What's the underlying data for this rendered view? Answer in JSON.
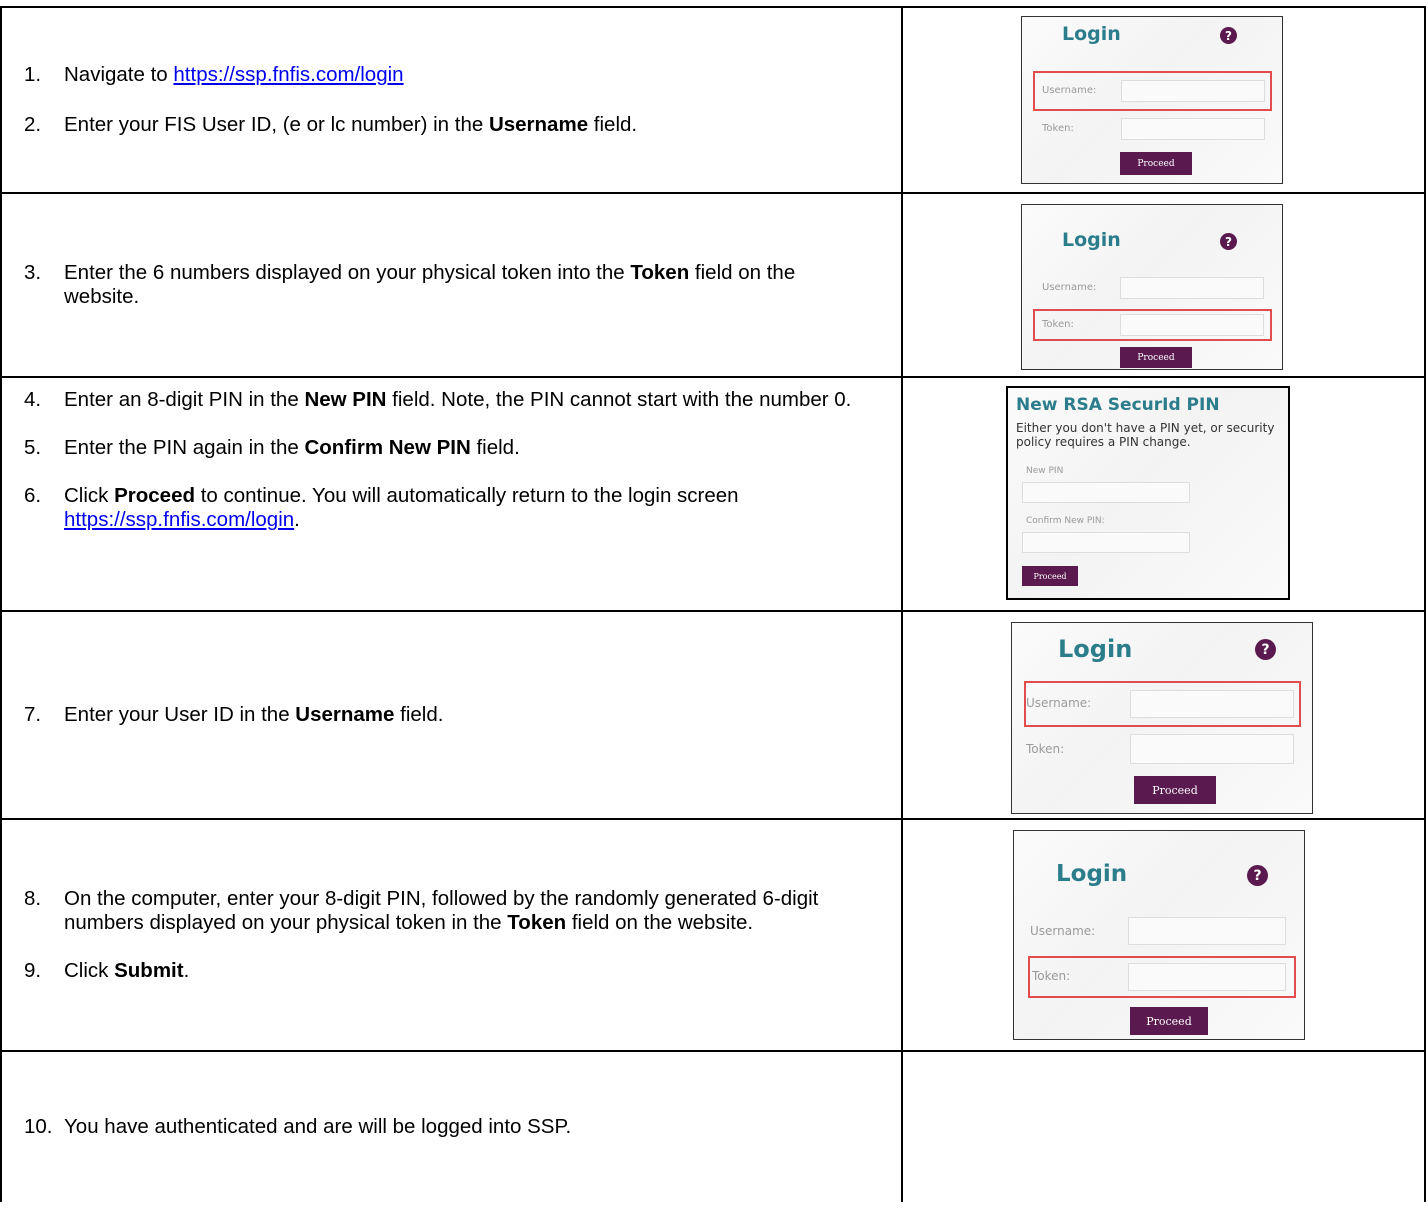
{
  "steps": {
    "s1": {
      "num": "1.",
      "prefix": "Navigate to ",
      "link": "https://ssp.fnfis.com/login"
    },
    "s2": {
      "num": "2.",
      "prefix": "Enter your FIS User ID, (e or lc number) in the ",
      "bold": "Username",
      "suffix": " field."
    },
    "s3": {
      "num": "3.",
      "prefix": "Enter the 6 numbers displayed on your physical token into the ",
      "bold": "Token",
      "suffix": " field on the website."
    },
    "s4": {
      "num": "4.",
      "prefix": "Enter an 8-digit PIN in the ",
      "bold": "New PIN",
      "suffix": " field. Note, the PIN cannot start with the number 0."
    },
    "s5": {
      "num": "5.",
      "prefix": "Enter the PIN again in the ",
      "bold": "Confirm New PIN",
      "suffix": " field."
    },
    "s6": {
      "num": "6.",
      "prefix": "Click ",
      "bold": "Proceed",
      "middle": " to continue. You will automatically return to the login screen ",
      "link": "https://ssp.fnfis.com/login",
      "suffix": "."
    },
    "s7": {
      "num": "7.",
      "prefix": "Enter your User ID in the ",
      "bold": "Username",
      "suffix": " field."
    },
    "s8": {
      "num": "8.",
      "prefix": "On the computer, enter your 8-digit PIN, followed by the randomly generated 6-digit numbers displayed on your physical token in the ",
      "bold": "Token",
      "suffix": " field on the website."
    },
    "s9": {
      "num": "9.",
      "prefix": "Click ",
      "bold": "Submit",
      "suffix": "."
    },
    "s10": {
      "num": "10.",
      "text": "You have authenticated and are will be logged into SSP."
    }
  },
  "login": {
    "title": "Login",
    "help_glyph": "?",
    "username_label": "Username:",
    "token_label": "Token:",
    "proceed_label": "Proceed"
  },
  "pin_screen": {
    "title": "New RSA SecurId PIN",
    "description": "Either you don't have a PIN yet, or security policy requires a PIN change.",
    "new_pin_label": "New PIN",
    "confirm_pin_label": "Confirm New PIN:",
    "proceed_label": "Proceed"
  },
  "colors": {
    "accent_teal": "#2c7d8c",
    "button_purple": "#5b1a4f",
    "highlight_red": "#e24c4c",
    "link_blue": "#0000ee"
  },
  "icons": [
    "help-icon"
  ]
}
